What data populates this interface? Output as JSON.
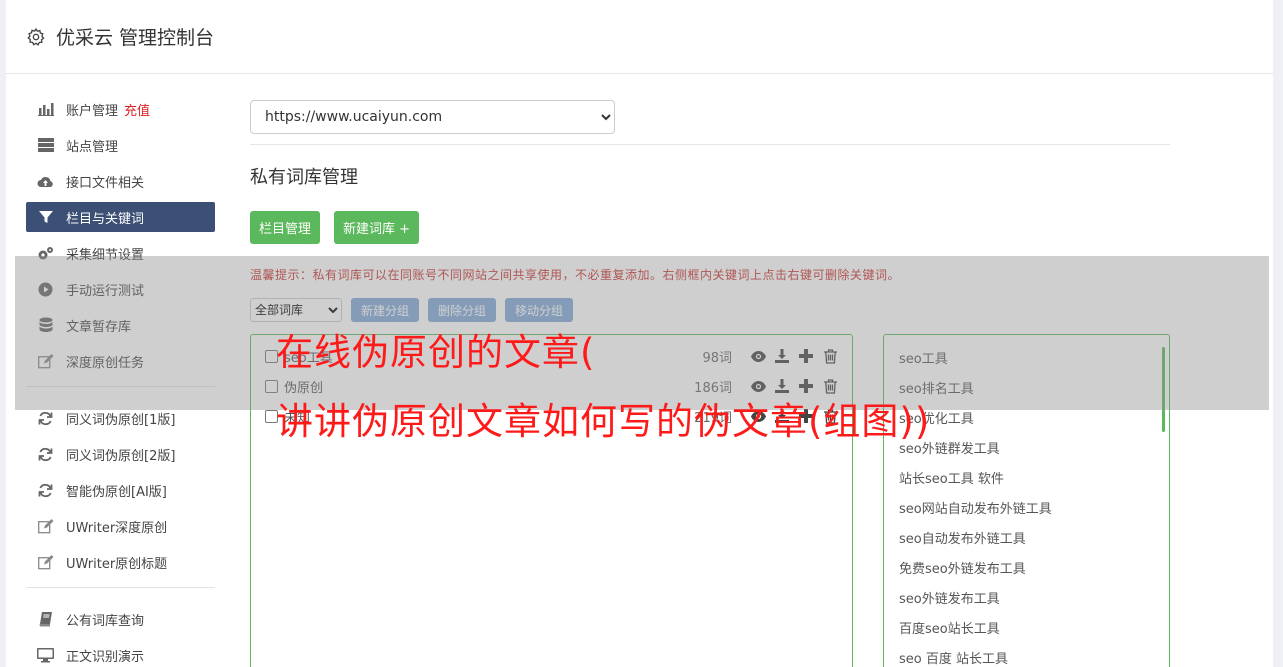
{
  "header": {
    "title": "优采云 管理控制台"
  },
  "sidebar": {
    "group1": [
      {
        "label": "账户管理",
        "badge": "充值",
        "icon": "bar-chart-icon"
      },
      {
        "label": "站点管理",
        "icon": "server-icon"
      },
      {
        "label": "接口文件相关",
        "icon": "cloud-upload-icon"
      },
      {
        "label": "栏目与关键词",
        "icon": "filter-icon",
        "active": true
      },
      {
        "label": "采集细节设置",
        "icon": "cogs-icon"
      },
      {
        "label": "手动运行测试",
        "icon": "play-circle-icon"
      },
      {
        "label": "文章暂存库",
        "icon": "database-icon"
      },
      {
        "label": "深度原创任务",
        "icon": "edit-icon"
      }
    ],
    "group2": [
      {
        "label": "同义词伪原创[1版]",
        "icon": "refresh-icon"
      },
      {
        "label": "同义词伪原创[2版]",
        "icon": "refresh-icon"
      },
      {
        "label": "智能伪原创[AI版]",
        "icon": "refresh-icon"
      },
      {
        "label": "UWriter深度原创",
        "icon": "edit-icon"
      },
      {
        "label": "UWriter原创标题",
        "icon": "edit-icon"
      }
    ],
    "group3": [
      {
        "label": "公有词库查询",
        "icon": "book-icon"
      },
      {
        "label": "正文识别演示",
        "icon": "monitor-icon"
      }
    ]
  },
  "main": {
    "site_select": "https://www.ucaiyun.com",
    "section_title": "私有词库管理",
    "btn_column": "栏目管理",
    "btn_new_lib": "新建词库 +",
    "tip": "温馨提示：私有词库可以在同账号不同网站之间共享使用，不必重复添加。右侧框内关键词上点击右键可删除关键词。",
    "filter_select": "全部词库",
    "btn_new_group": "新建分组",
    "btn_delete_group": "删除分组",
    "btn_move_group": "移动分组",
    "libraries": [
      {
        "name": "seo工具",
        "count": "98词"
      },
      {
        "name": "伪原创",
        "count": "186词"
      },
      {
        "name": "未知",
        "count": "219词"
      }
    ],
    "keywords": [
      "seo工具",
      "seo排名工具",
      "seo优化工具",
      "seo外链群发工具",
      "站长seo工具 软件",
      "seo网站自动发布外链工具",
      "seo自动发布外链工具",
      "免费seo外链发布工具",
      "seo外链发布工具",
      "百度seo站长工具",
      "seo 百度 站长工具"
    ]
  },
  "overlay": {
    "line1": "在线伪原创的文章(",
    "line2": "讲讲伪原创文章如何写的伪文章(组图))"
  },
  "colors": {
    "green": "#5cb85c",
    "active_nav": "#3c4f74",
    "blue_btn": "#7fa8d8",
    "tip_red": "#c9302c",
    "overlay_red": "#ff1a1a"
  }
}
